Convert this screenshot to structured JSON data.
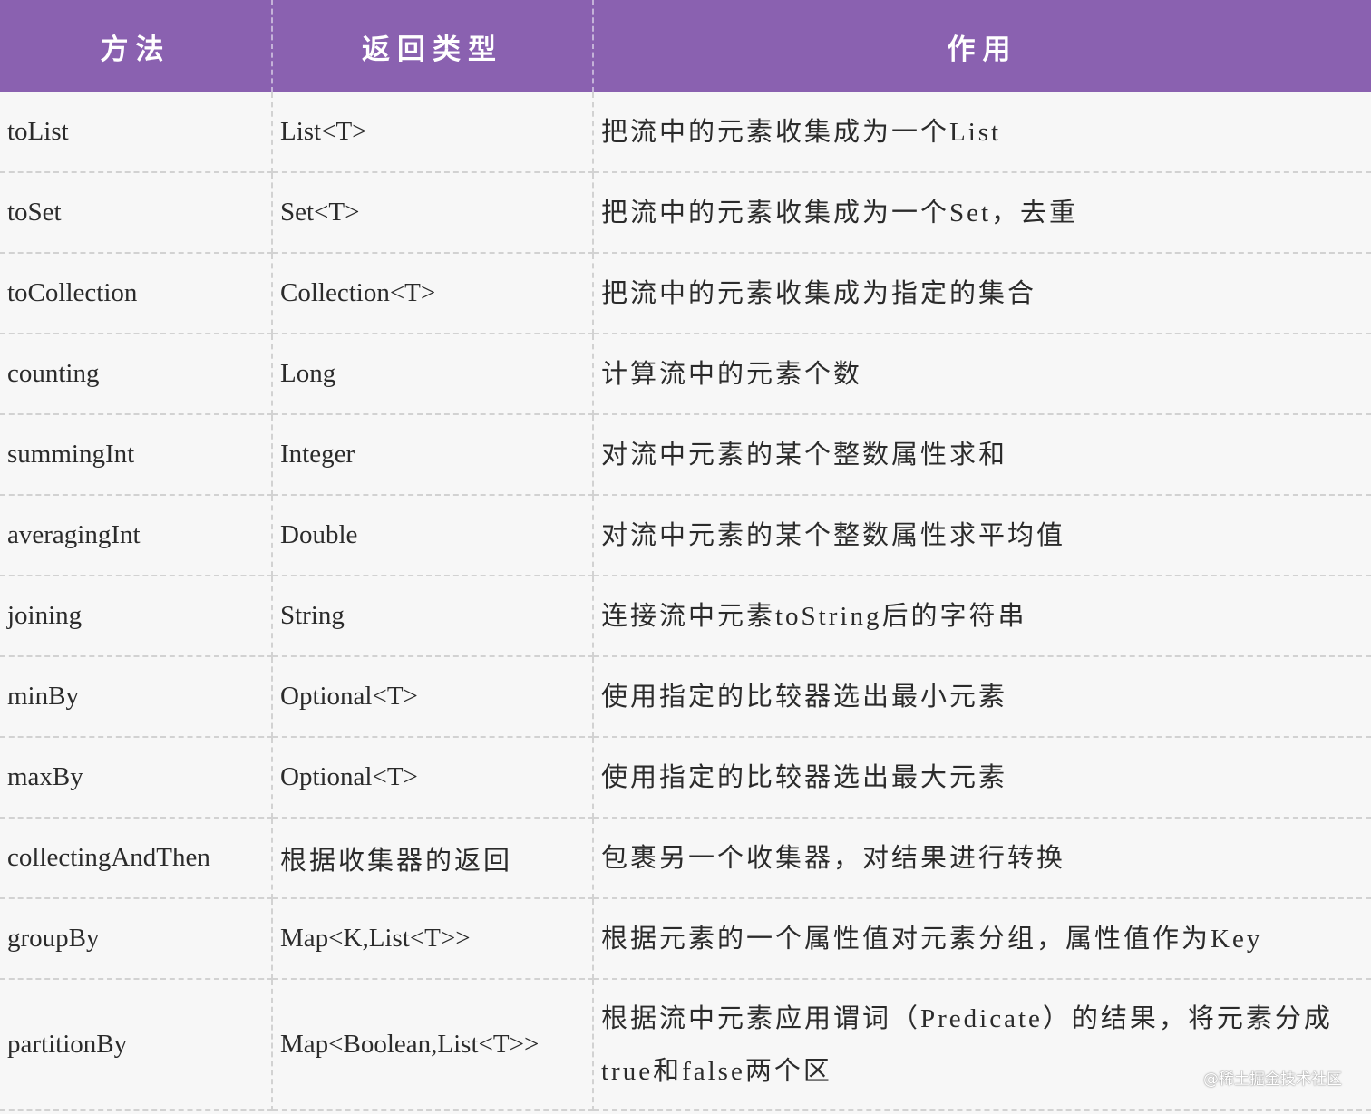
{
  "header": {
    "method": "方法",
    "return_type": "返回类型",
    "purpose": "作用"
  },
  "rows": [
    {
      "method": "toList",
      "return_type": "List<T>",
      "purpose": "把流中的元素收集成为一个List"
    },
    {
      "method": "toSet",
      "return_type": "Set<T>",
      "purpose": "把流中的元素收集成为一个Set，去重"
    },
    {
      "method": "toCollection",
      "return_type": "Collection<T>",
      "purpose": "把流中的元素收集成为指定的集合"
    },
    {
      "method": "counting",
      "return_type": "Long",
      "purpose": "计算流中的元素个数"
    },
    {
      "method": "summingInt",
      "return_type": "Integer",
      "purpose": "对流中元素的某个整数属性求和"
    },
    {
      "method": "averagingInt",
      "return_type": "Double",
      "purpose": "对流中元素的某个整数属性求平均值"
    },
    {
      "method": "joining",
      "return_type": "String",
      "purpose": "连接流中元素toString后的字符串"
    },
    {
      "method": "minBy",
      "return_type": "Optional<T>",
      "purpose": "使用指定的比较器选出最小元素"
    },
    {
      "method": "maxBy",
      "return_type": "Optional<T>",
      "purpose": "使用指定的比较器选出最大元素"
    },
    {
      "method": "collectingAndThen",
      "return_type": "根据收集器的返回",
      "purpose": "包裹另一个收集器，对结果进行转换"
    },
    {
      "method": "groupBy",
      "return_type": "Map<K,List<T>>",
      "purpose": "根据元素的一个属性值对元素分组，属性值作为Key"
    },
    {
      "method": "partitionBy",
      "return_type": "Map<Boolean,List<T>>",
      "purpose": "根据流中元素应用谓词（Predicate）的结果，将元素分成true和false两个区"
    }
  ],
  "watermark": "@稀土掘金技术社区",
  "colors": {
    "header_bg": "#8a61b0",
    "header_text": "#ffffff",
    "body_bg": "#f7f7f7",
    "grid": "#d2d2d2"
  }
}
